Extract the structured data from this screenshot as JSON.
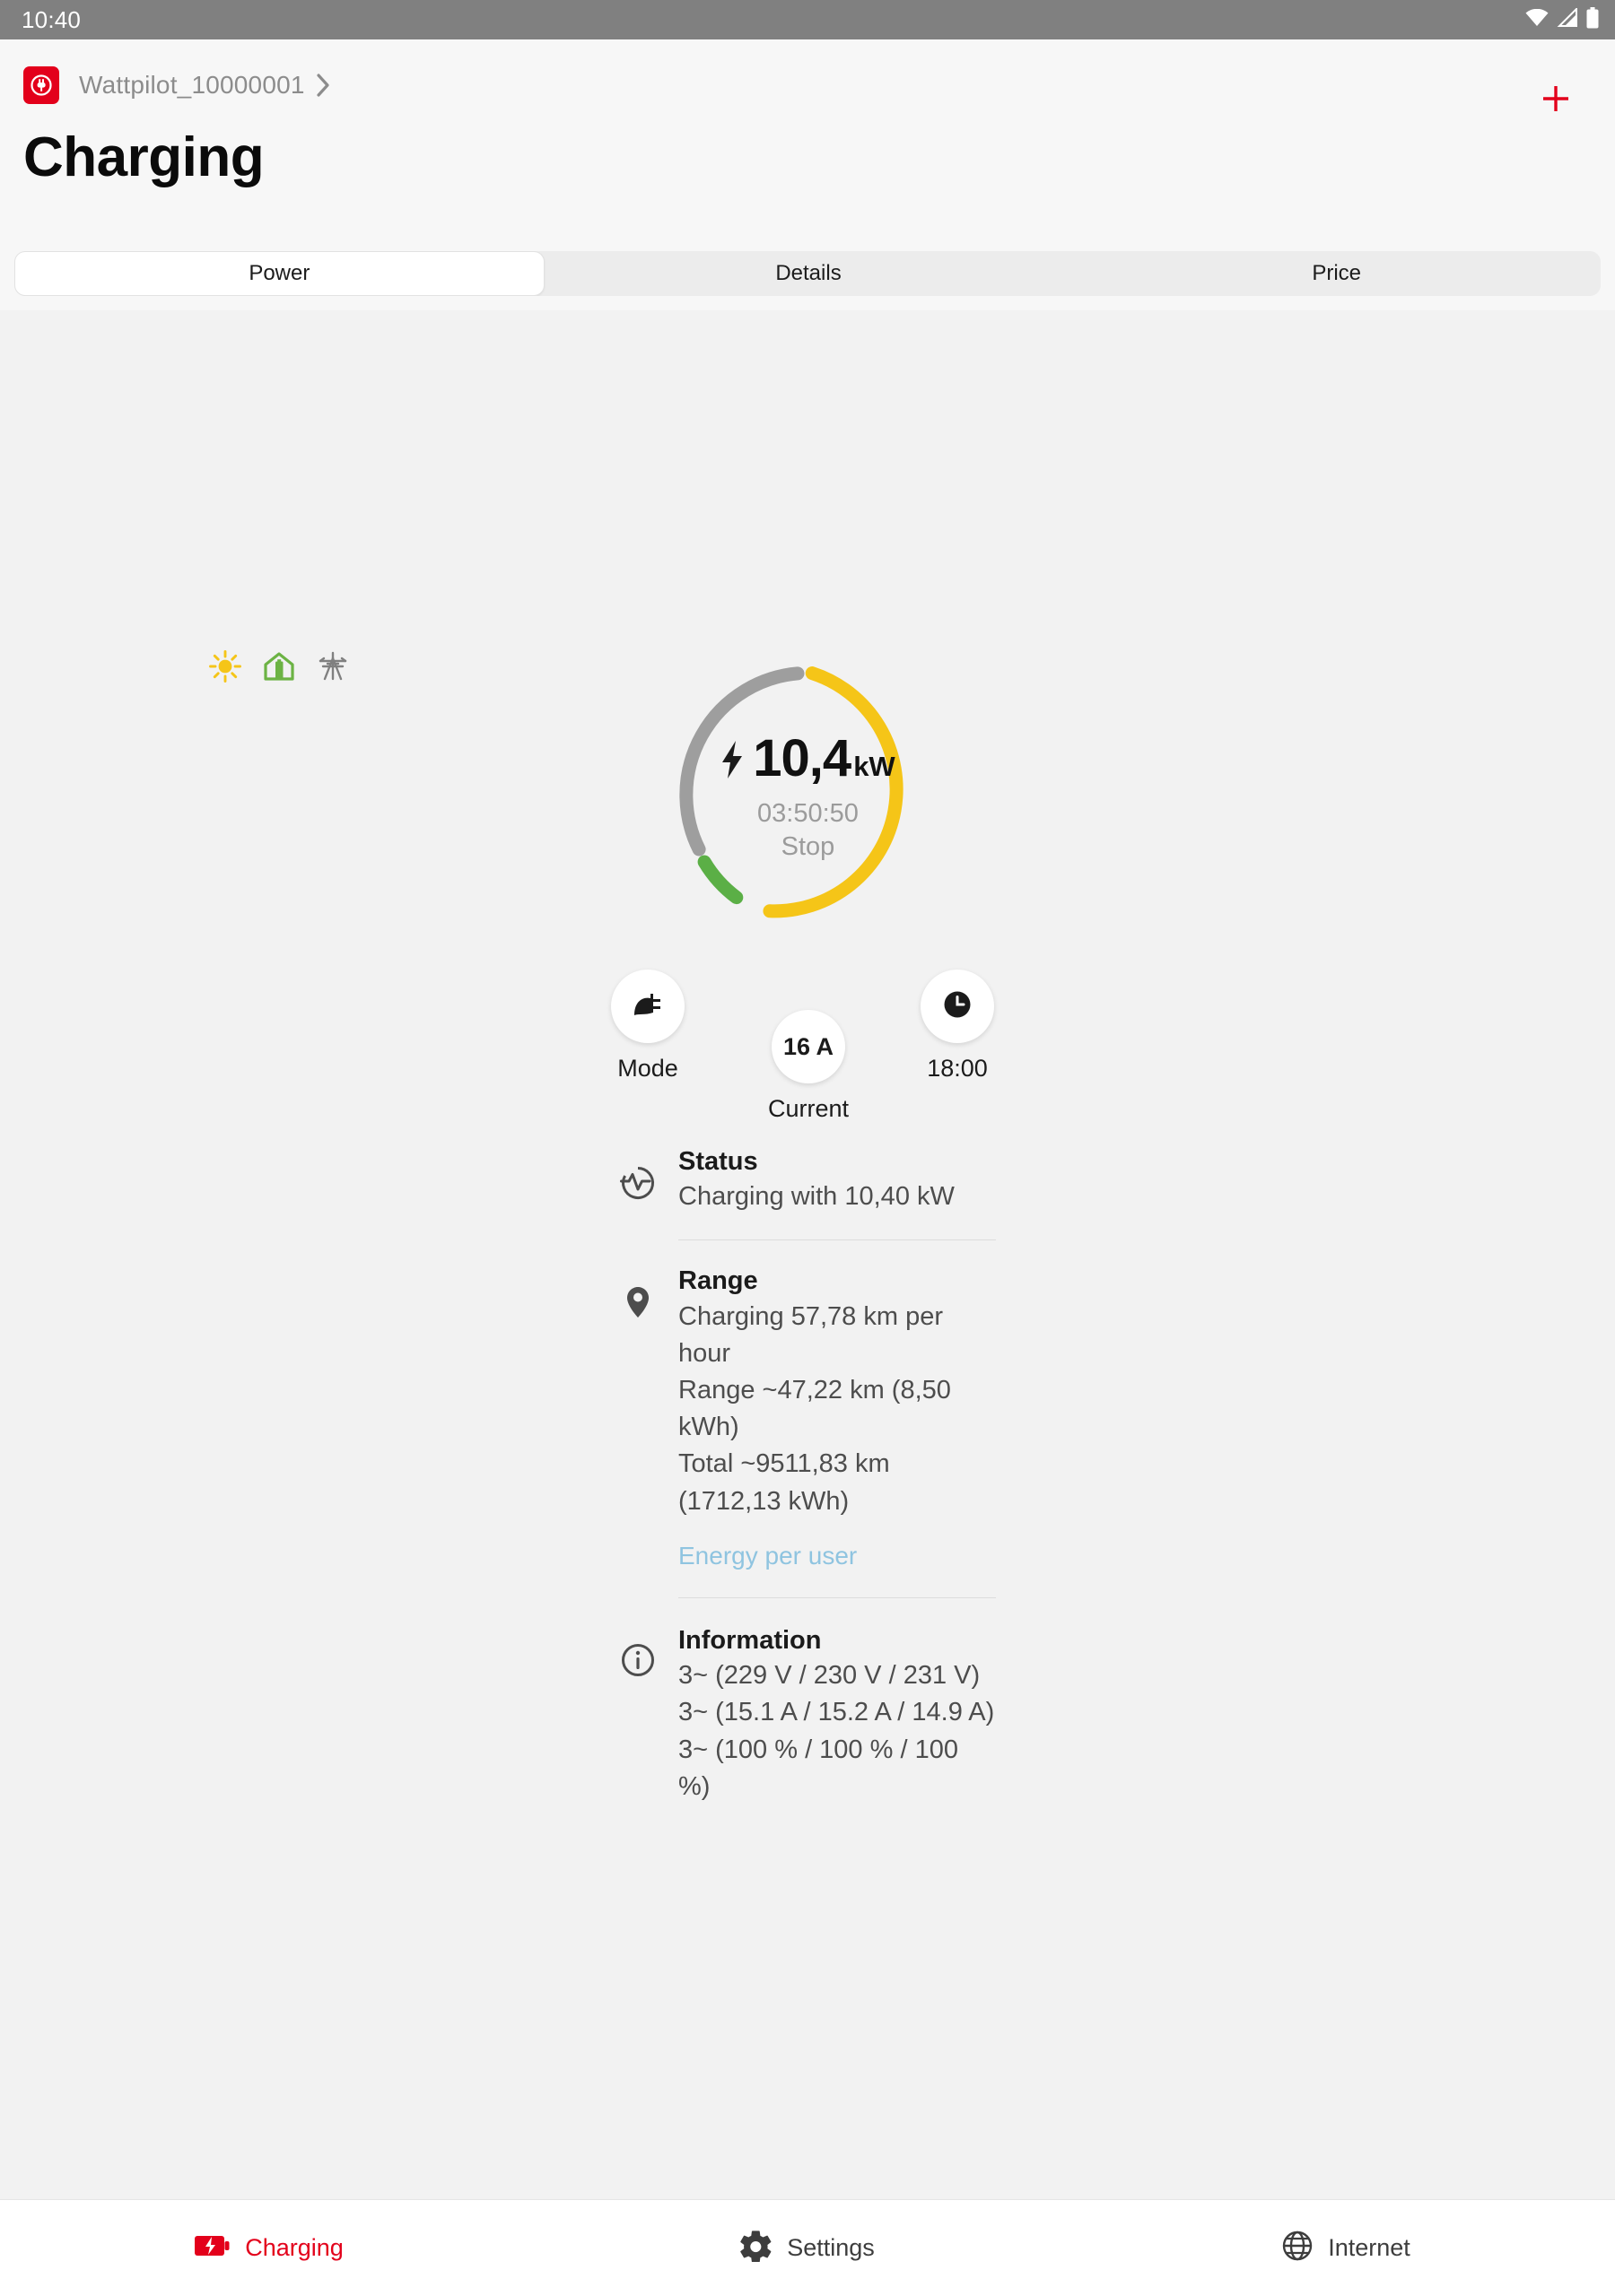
{
  "statusbar": {
    "time": "10:40",
    "icons": [
      "wifi-icon",
      "cellular-signal-icon",
      "battery-icon"
    ]
  },
  "header": {
    "logo_icon": "wattpilot-plug-logo",
    "device_name": "Wattpilot_10000001",
    "chevron_icon": "chevron-right-icon",
    "add_label": "+",
    "add_icon": "plus-icon",
    "page_title": "Charging"
  },
  "tabs": [
    {
      "label": "Power",
      "active": true
    },
    {
      "label": "Details",
      "active": false
    },
    {
      "label": "Price",
      "active": false
    }
  ],
  "source_icons": [
    {
      "name": "sun-icon",
      "color": "#F5C518"
    },
    {
      "name": "house-battery-icon",
      "color": "#6CB344"
    },
    {
      "name": "power-pylon-icon",
      "color": "#808080"
    }
  ],
  "gauge": {
    "bolt_icon": "lightning-bolt-icon",
    "value": "10,4",
    "unit": "kW",
    "timer": "03:50:50",
    "action_label": "Stop",
    "ring_segments": [
      {
        "name": "solar",
        "color": "#F5C518",
        "start_deg": 2,
        "end_deg": 163
      },
      {
        "name": "battery",
        "color": "#5BAF46",
        "start_deg": 168,
        "end_deg": 214
      },
      {
        "name": "grid",
        "color": "#9E9E9E",
        "start_deg": 219,
        "end_deg": 357
      }
    ]
  },
  "controls": [
    {
      "name": "mode-button",
      "icon": "plug-icon",
      "label": "Mode",
      "value": ""
    },
    {
      "name": "current-button",
      "icon": "",
      "label": "Current",
      "value": "16 A"
    },
    {
      "name": "timer-button",
      "icon": "clock-icon",
      "label": "18:00",
      "value": ""
    }
  ],
  "sections": [
    {
      "name": "status",
      "icon": "activity-pulse-icon",
      "title": "Status",
      "lines": [
        "Charging with 10,40 kW"
      ],
      "link": ""
    },
    {
      "name": "range",
      "icon": "location-pin-icon",
      "title": "Range",
      "lines": [
        "Charging 57,78 km per hour",
        "Range ~47,22 km (8,50 kWh)",
        "Total ~9511,83 km (1712,13 kWh)"
      ],
      "link": "Energy per user"
    },
    {
      "name": "information",
      "icon": "info-circle-icon",
      "title": "Information",
      "lines": [
        "3~ (229 V / 230 V / 231 V)",
        "3~ (15.1 A / 15.2 A / 14.9 A)",
        "3~ (100 % / 100 % / 100 %)"
      ],
      "link": ""
    }
  ],
  "bottomnav": [
    {
      "label": "Charging",
      "icon": "battery-charging-icon",
      "active": true
    },
    {
      "label": "Settings",
      "icon": "gear-icon",
      "active": false
    },
    {
      "label": "Internet",
      "icon": "globe-icon",
      "active": false
    }
  ],
  "colors": {
    "brand_red": "#E3001B",
    "solar_yellow": "#F5C518",
    "battery_green": "#5BAF46",
    "grid_gray": "#9E9E9E",
    "link_blue": "#8FC4E0"
  }
}
